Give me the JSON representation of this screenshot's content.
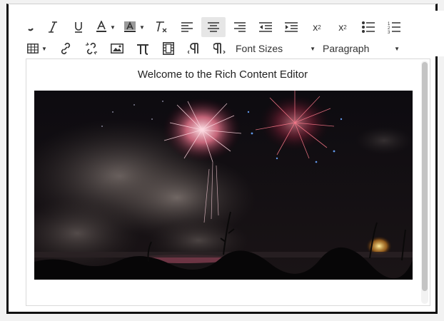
{
  "toolbar": {
    "row1": [
      {
        "name": "bold-button",
        "glyph": ""
      },
      {
        "name": "italic-button",
        "glyph": "I"
      },
      {
        "name": "underline-button",
        "glyph": "U"
      },
      {
        "name": "text-color-button",
        "glyph": "A"
      },
      {
        "name": "background-color-button",
        "glyph": "A"
      },
      {
        "name": "clear-formatting-button",
        "glyph": "T"
      },
      {
        "name": "align-left-button"
      },
      {
        "name": "align-center-button"
      },
      {
        "name": "align-right-button"
      },
      {
        "name": "outdent-button"
      },
      {
        "name": "indent-button"
      },
      {
        "name": "superscript-button",
        "glyph": "x²"
      },
      {
        "name": "subscript-button",
        "glyph": "x₂"
      },
      {
        "name": "bullet-list-button"
      },
      {
        "name": "numbered-list-button"
      }
    ],
    "font_sizes_label": "Font Sizes",
    "paragraph_label": "Paragraph"
  },
  "editor": {
    "heading": "Welcome to the Rich Content Editor"
  },
  "colors": {
    "icon": "#333333",
    "active_button_bg": "#e6e6e6",
    "editor_border": "#d9d9d9",
    "scrollbar_thumb": "#c4c4c4"
  }
}
